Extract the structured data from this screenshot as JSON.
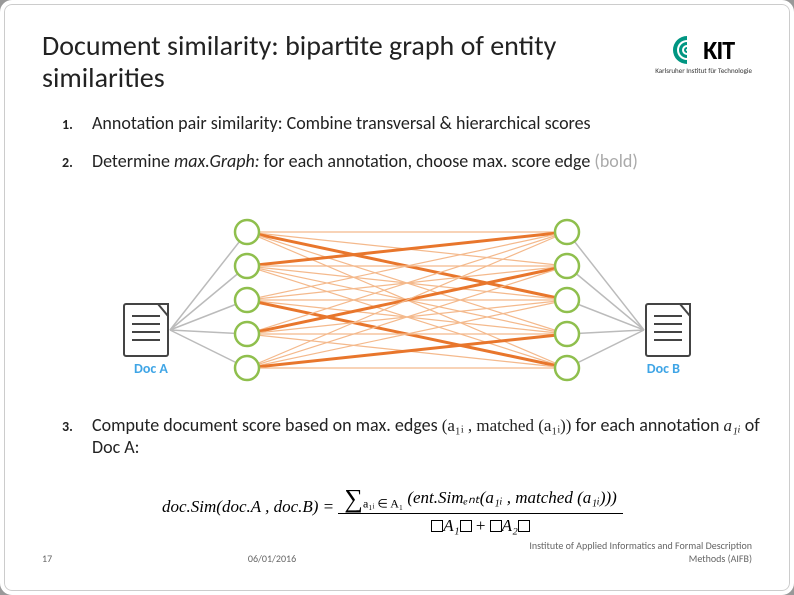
{
  "title": "Document similarity: bipartite graph of entity similarities",
  "logo": {
    "text": "KIT",
    "sub": "Karlsruher Institut für Technologie"
  },
  "points": {
    "p1": "Annotation pair similarity: Combine transversal & hierarchical scores",
    "p2_a": "Determine ",
    "p2_em": "max.Graph:",
    "p2_b": " for each annotation, choose max. score edge ",
    "p2_muted": "(bold)",
    "p3_a": "Compute document score based on max. edges ",
    "p3_b": " for each annotation ",
    "p3_c": " of Doc A:"
  },
  "formula_pair": "(a₁ᵢ , matched (a₁ᵢ))",
  "formula_a1i": "a₁ᵢ",
  "graph": {
    "docA": "Doc A",
    "docB": "Doc B",
    "left_nodes": 5,
    "right_nodes": 5,
    "bold_edges": [
      [
        0,
        2
      ],
      [
        1,
        0
      ],
      [
        2,
        4
      ],
      [
        3,
        1
      ],
      [
        4,
        3
      ]
    ]
  },
  "main_formula": {
    "lhs": "doc.Sim(doc.A , doc.B) =",
    "sum_sub": "a₁ᵢ ∈ A₁",
    "sum_body": "(ent.Simₑₙₜ(a₁ᵢ , matched (a₁ᵢ)))",
    "den_a": "A₁",
    "den_plus": " + ",
    "den_b": "A₂"
  },
  "footer": {
    "page": "17",
    "date": "06/01/2016",
    "inst": "Institute of Applied Informatics and Formal Description Methods (AIFB)"
  }
}
